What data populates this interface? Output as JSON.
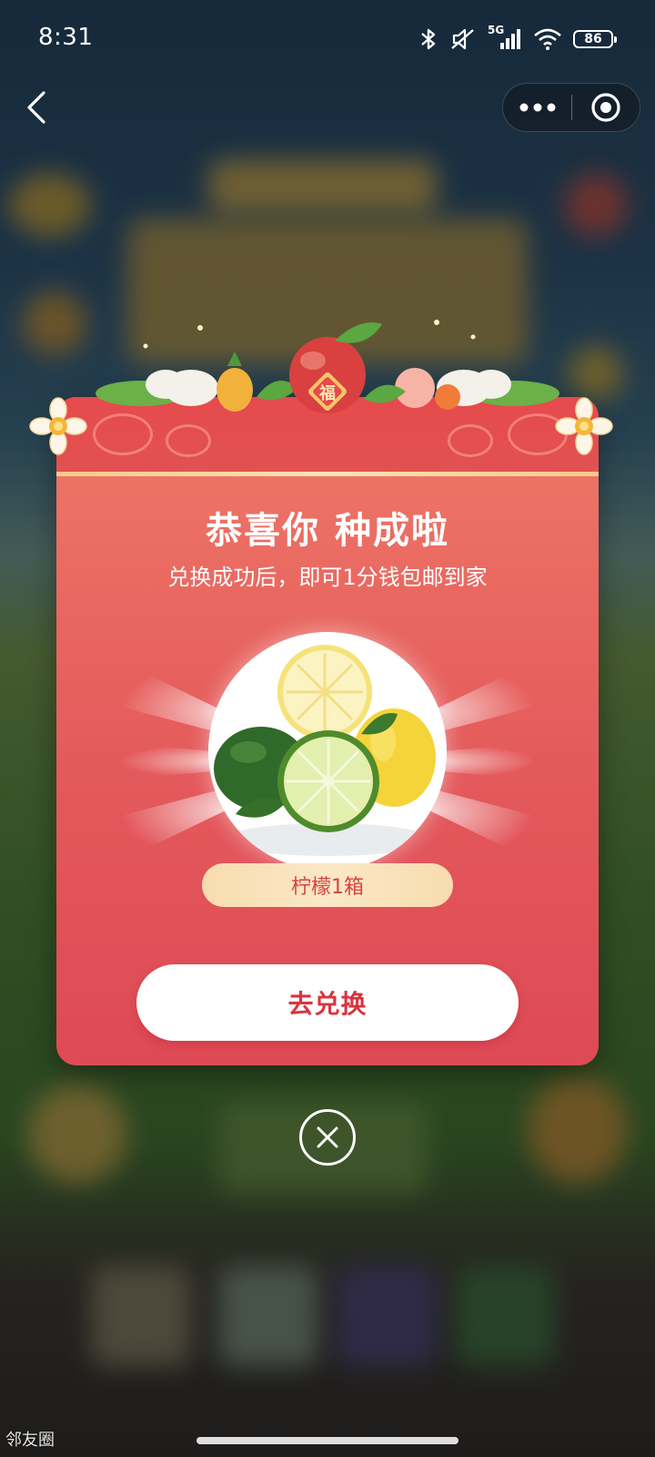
{
  "status_bar": {
    "time": "8:31",
    "network": "5G",
    "battery": "86",
    "icons": [
      "bluetooth-icon",
      "mute-icon",
      "signal-icon",
      "wifi-icon",
      "battery-icon"
    ]
  },
  "nav": {
    "back_icon": "chevron-left-icon",
    "more_icon": "more-dots-icon",
    "close_icon": "target-close-icon"
  },
  "modal": {
    "title": "恭喜你 种成啦",
    "subtitle": "兑换成功后，即可1分钱包邮到家",
    "badge_char": "福",
    "prize_name": "柠檬1箱",
    "redeem_button": "去兑换",
    "close_icon": "close-circle-icon"
  },
  "watermark": "邻友圈",
  "colors": {
    "card_top": "#ef7a6a",
    "card_bottom": "#de4a55",
    "button_text": "#d8343f",
    "pill_bg": "#f7dcae"
  }
}
